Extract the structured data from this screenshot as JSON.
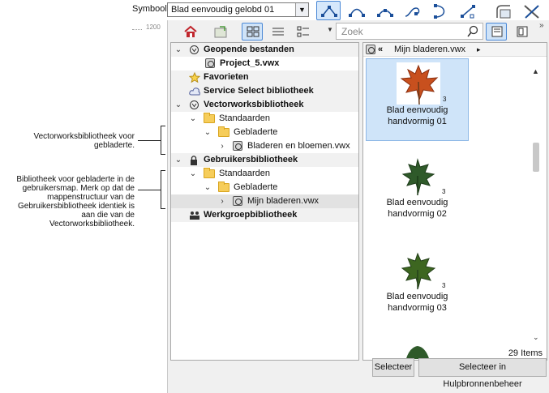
{
  "top": {
    "symbol_label": "Symbool",
    "symbol_value": "Blad eenvoudig gelobd 01",
    "ruler_value": "1200",
    "tools": [
      "vertex-tool",
      "arc-tool",
      "arc-tool-2",
      "spiral-tool",
      "curve-tool",
      "bezier-tool",
      "symbol-insert-tool",
      "settings-tool"
    ]
  },
  "palette": {
    "search_placeholder": "Zoek",
    "more": "»",
    "tree": [
      {
        "label": "Geopende bestanden",
        "level": 0,
        "type": "head",
        "expanded": true
      },
      {
        "label": "Project_5.vwx",
        "level": 1,
        "type": "file"
      },
      {
        "label": "Favorieten",
        "level": 0,
        "type": "head"
      },
      {
        "label": "Service Select bibliotheek",
        "level": 0,
        "type": "head"
      },
      {
        "label": "Vectorworksbibliotheek",
        "level": 0,
        "type": "head",
        "expanded": true
      },
      {
        "label": "Standaarden",
        "level": 1,
        "type": "folder",
        "expanded": true
      },
      {
        "label": "Gebladerte",
        "level": 2,
        "type": "folder",
        "expanded": true
      },
      {
        "label": "Bladeren en bloemen.vwx",
        "level": 3,
        "type": "file"
      },
      {
        "label": "Gebruikersbibliotheek",
        "level": 0,
        "type": "head",
        "expanded": true
      },
      {
        "label": "Standaarden",
        "level": 1,
        "type": "folder",
        "expanded": true
      },
      {
        "label": "Gebladerte",
        "level": 2,
        "type": "folder",
        "expanded": true
      },
      {
        "label": "Mijn bladeren.vwx",
        "level": 3,
        "type": "file",
        "selected": true
      },
      {
        "label": "Werkgroepbibliotheek",
        "level": 0,
        "type": "head"
      }
    ],
    "breadcrumb": {
      "back": "«",
      "name": "Mijn bladeren.vwx",
      "forward": "▸"
    },
    "tiles": [
      {
        "caption": "Blad eenvoudig handvormig 01",
        "color": "#c8501e"
      },
      {
        "caption": "Blad eenvoudig handvormig 02",
        "color": "#2f5a2a"
      },
      {
        "caption": "Blad eenvoudig handvormig 03",
        "color": "#3d6620"
      }
    ],
    "item_count": "29 Items",
    "select_button": "Selecteer",
    "select_manager_button": "Selecteer in Hulpbronnenbeheer"
  },
  "annotations": {
    "note1": "Vectorworksbibliotheek voor gebladerte.",
    "note2": "Bibliotheek voor gebladerte in de gebruikersmap. Merk op dat de mappenstructuur van de Gebruikersbibliotheek identiek is aan die van de Vectorworksbibliotheek."
  }
}
